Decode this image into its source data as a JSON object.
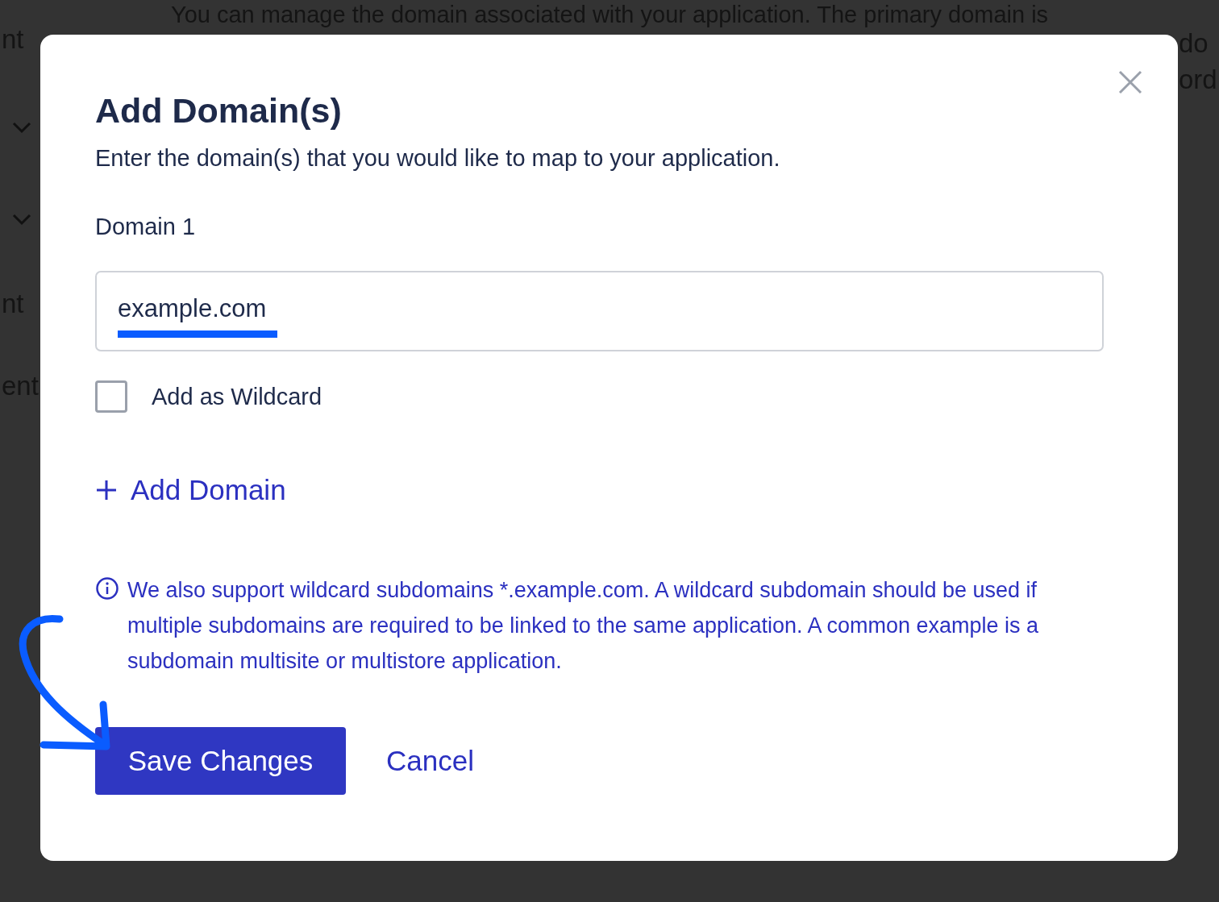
{
  "background": {
    "intro_text": "You can manage the domain associated with your application. The primary domain is",
    "left_fragments": [
      "nt",
      "nt",
      "ent"
    ],
    "right_fragments": [
      "do",
      "ord"
    ]
  },
  "dialog": {
    "title": "Add Domain(s)",
    "subtitle": "Enter the domain(s) that you would like to map to your application.",
    "field_label": "Domain 1",
    "field_value": "example.com",
    "wildcard": {
      "label": "Add as Wildcard",
      "checked": false
    },
    "add_link": "Add Domain",
    "info": "We also support wildcard subdomains *.example.com. A wildcard subdomain should be used if multiple subdomains are required to be linked to the same application. A common example is a subdomain multisite or multistore application.",
    "buttons": [
      {
        "kind": "primary",
        "label": "Save Changes"
      },
      {
        "kind": "link",
        "label": "Cancel"
      }
    ]
  }
}
